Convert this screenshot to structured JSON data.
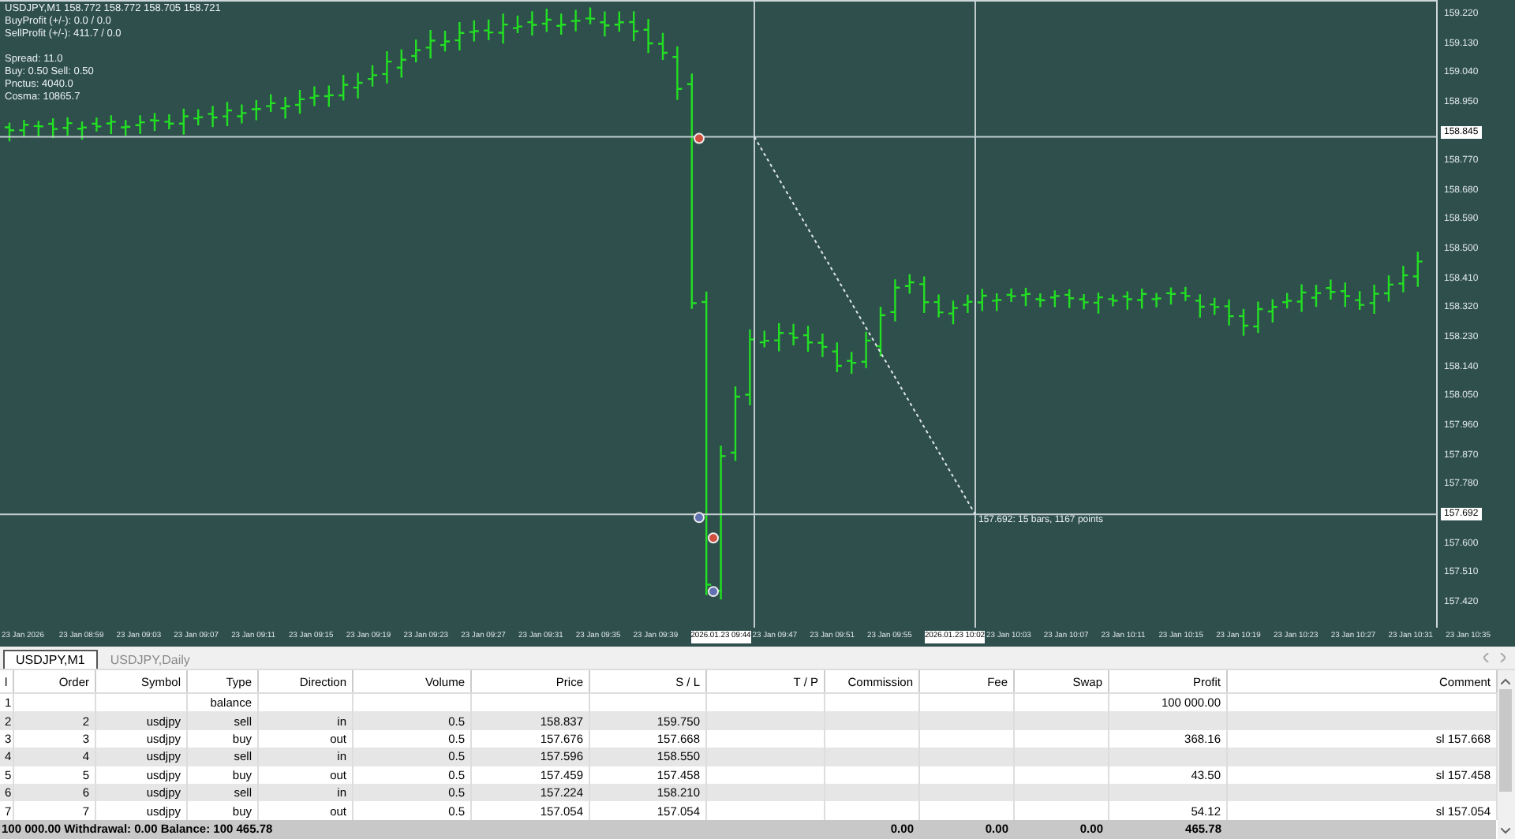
{
  "chart": {
    "info_groups": [
      [
        "USDJPY,M1  158.772 158.772 158.705 158.721",
        "BuyProfit (+/-): 0.0 / 0.0",
        "SellProfit (+/-): 411.7 / 0.0"
      ],
      [
        "Spread: 11.0",
        "Buy: 0.50 Sell: 0.50",
        "Pnctus: 4040.0",
        "Cosma: 10865.7"
      ]
    ],
    "price_labels": [
      {
        "label": "159.220",
        "highlighted": false
      },
      {
        "label": "159.130",
        "highlighted": false
      },
      {
        "label": "159.040",
        "highlighted": false
      },
      {
        "label": "158.950",
        "highlighted": false
      },
      {
        "label": "158.845",
        "highlighted": true
      },
      {
        "label": "158.770",
        "highlighted": false
      },
      {
        "label": "158.680",
        "highlighted": false
      },
      {
        "label": "158.590",
        "highlighted": false
      },
      {
        "label": "158.500",
        "highlighted": false
      },
      {
        "label": "158.410",
        "highlighted": false
      },
      {
        "label": "158.320",
        "highlighted": false
      },
      {
        "label": "158.230",
        "highlighted": false
      },
      {
        "label": "158.140",
        "highlighted": false
      },
      {
        "label": "158.050",
        "highlighted": false
      },
      {
        "label": "157.960",
        "highlighted": false
      },
      {
        "label": "157.870",
        "highlighted": false
      },
      {
        "label": "157.780",
        "highlighted": false
      },
      {
        "label": "157.692",
        "highlighted": true
      },
      {
        "label": "157.600",
        "highlighted": false
      },
      {
        "label": "157.510",
        "highlighted": false
      },
      {
        "label": "157.420",
        "highlighted": false
      }
    ],
    "time_labels": [
      {
        "label": "23 Jan 2026",
        "highlighted": false
      },
      {
        "label": "23 Jan 08:59",
        "highlighted": false
      },
      {
        "label": "23 Jan 09:03",
        "highlighted": false
      },
      {
        "label": "23 Jan 09:07",
        "highlighted": false
      },
      {
        "label": "23 Jan 09:11",
        "highlighted": false
      },
      {
        "label": "23 Jan 09:15",
        "highlighted": false
      },
      {
        "label": "23 Jan 09:19",
        "highlighted": false
      },
      {
        "label": "23 Jan 09:23",
        "highlighted": false
      },
      {
        "label": "23 Jan 09:27",
        "highlighted": false
      },
      {
        "label": "23 Jan 09:31",
        "highlighted": false
      },
      {
        "label": "23 Jan 09:35",
        "highlighted": false
      },
      {
        "label": "23 Jan 09:39",
        "highlighted": false
      },
      {
        "label": "2026.01.23 09:44",
        "highlighted": true
      },
      {
        "label": "23 Jan 09:47",
        "highlighted": false
      },
      {
        "label": "23 Jan 09:51",
        "highlighted": false
      },
      {
        "label": "23 Jan 09:55",
        "highlighted": false
      },
      {
        "label": "2026.01.23 10:02",
        "highlighted": true
      },
      {
        "label": "23 Jan 10:03",
        "highlighted": false
      },
      {
        "label": "23 Jan 10:07",
        "highlighted": false
      },
      {
        "label": "23 Jan 10:11",
        "highlighted": false
      },
      {
        "label": "23 Jan 10:15",
        "highlighted": false
      },
      {
        "label": "23 Jan 10:19",
        "highlighted": false
      },
      {
        "label": "23 Jan 10:23",
        "highlighted": false
      },
      {
        "label": "23 Jan 10:27",
        "highlighted": false
      },
      {
        "label": "23 Jan 10:31",
        "highlighted": false
      },
      {
        "label": "23 Jan 10:35",
        "highlighted": false
      }
    ],
    "measure_label": "157.692: 15 bars, 1167 points"
  },
  "tabs": [
    {
      "label": "USDJPY,M1",
      "selected": true
    },
    {
      "label": "USDJPY,Daily",
      "selected": false
    }
  ],
  "table": {
    "columns": [
      "l",
      "Order",
      "Symbol",
      "Type",
      "Direction",
      "Volume",
      "Price",
      "S / L",
      "T / P",
      "Commission",
      "Fee",
      "Swap",
      "Profit",
      "Comment"
    ],
    "rows": [
      {
        "deal": "1",
        "type": "balance",
        "profit": "100 000.00"
      },
      {
        "deal": "2",
        "order": "2",
        "symbol": "usdjpy",
        "type": "sell",
        "direction": "in",
        "volume": "0.5",
        "price": "158.837",
        "sl": "159.750"
      },
      {
        "deal": "3",
        "order": "3",
        "symbol": "usdjpy",
        "type": "buy",
        "direction": "out",
        "volume": "0.5",
        "price": "157.676",
        "sl": "157.668",
        "profit": "368.16",
        "comment": "sl 157.668"
      },
      {
        "deal": "4",
        "order": "4",
        "symbol": "usdjpy",
        "type": "sell",
        "direction": "in",
        "volume": "0.5",
        "price": "157.596",
        "sl": "158.550"
      },
      {
        "deal": "5",
        "order": "5",
        "symbol": "usdjpy",
        "type": "buy",
        "direction": "out",
        "volume": "0.5",
        "price": "157.459",
        "sl": "157.458",
        "profit": "43.50",
        "comment": "sl 157.458"
      },
      {
        "deal": "6",
        "order": "6",
        "symbol": "usdjpy",
        "type": "sell",
        "direction": "in",
        "volume": "0.5",
        "price": "157.224",
        "sl": "158.210"
      },
      {
        "deal": "7",
        "order": "7",
        "symbol": "usdjpy",
        "type": "buy",
        "direction": "out",
        "volume": "0.5",
        "price": "157.054",
        "sl": "157.054",
        "profit": "54.12",
        "comment": "sl 157.054"
      }
    ],
    "totals": {
      "summary": "100 000.00  Withdrawal: 0.00  Balance: 100 465.78",
      "commission": "0.00",
      "fee": "0.00",
      "swap": "0.00",
      "profit": "465.78"
    }
  }
}
